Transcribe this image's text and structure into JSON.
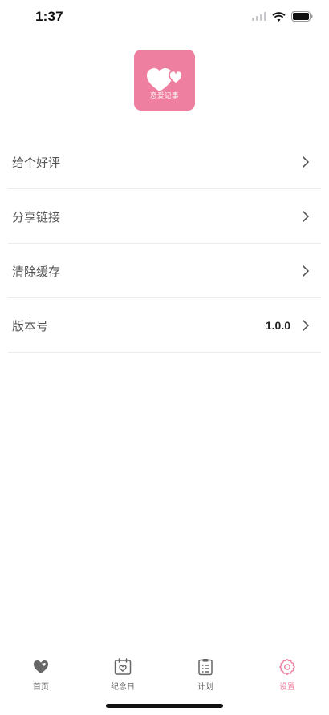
{
  "status_bar": {
    "time": "1:37"
  },
  "app_logo": {
    "text": "恋爱记事",
    "color": "#ee7fa0"
  },
  "menu": {
    "items": [
      {
        "label": "给个好评"
      },
      {
        "label": "分享链接"
      },
      {
        "label": "清除缓存"
      },
      {
        "label": "版本号",
        "value": "1.0.0"
      }
    ]
  },
  "tabbar": {
    "active_color": "#ee7fa0",
    "tabs": [
      {
        "label": "首页",
        "icon": "heart-chat-icon"
      },
      {
        "label": "纪念日",
        "icon": "calendar-heart-icon"
      },
      {
        "label": "计划",
        "icon": "clipboard-list-icon"
      },
      {
        "label": "设置",
        "icon": "gear-icon",
        "active": true
      }
    ]
  }
}
